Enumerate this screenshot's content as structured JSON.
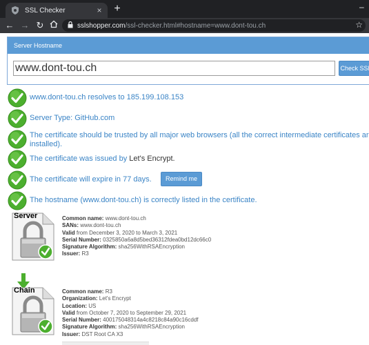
{
  "browser": {
    "tab_title": "SSL Checker",
    "url_host": "sslshopper.com",
    "url_path": "/ssl-checker.html#hostname=www.dont-tou.ch",
    "new_tab": "+",
    "tab_close": "×"
  },
  "form": {
    "header": "Server Hostname",
    "hostname_value": "www.dont-tou.ch",
    "check_button": "Check SSL"
  },
  "results": [
    {
      "text": "www.dont-tou.ch resolves to 185.199.108.153"
    },
    {
      "text": "Server Type: GitHub.com"
    },
    {
      "text": "The certificate should be trusted by all major web browsers (all the correct intermediate certificates are installed)."
    },
    {
      "text_prefix": "The certificate was issued by ",
      "text_value": "Let's Encrypt",
      "text_suffix": "."
    },
    {
      "text": "The certificate will expire in 77 days.",
      "button": "Remind me"
    },
    {
      "text": "The hostname (www.dont-tou.ch) is correctly listed in the certificate."
    }
  ],
  "server_cert": {
    "label": "Server",
    "common_name_label": "Common name:",
    "common_name": "www.dont-tou.ch",
    "sans_label": "SANs:",
    "sans": "www.dont-tou.ch",
    "valid_label": "Valid",
    "valid_text": "from December 3, 2020 to March 3, 2021",
    "serial_label": "Serial Number:",
    "serial": "0325850a6a8d5bed36312fdea0bd12dc66c0",
    "sigalg_label": "Signature Algorithm:",
    "sigalg": "sha256WithRSAEncryption",
    "issuer_label": "Issuer:",
    "issuer": "R3"
  },
  "chain_cert": {
    "label": "Chain",
    "common_name_label": "Common name:",
    "common_name": "R3",
    "org_label": "Organization:",
    "org": "Let's Encrypt",
    "location_label": "Location:",
    "location": "US",
    "valid_label": "Valid",
    "valid_text": "from October 7, 2020 to September 29, 2021",
    "serial_label": "Serial Number:",
    "serial": "400175048314a4c8218c84a90c16cddf",
    "sigalg_label": "Signature Algorithm:",
    "sigalg": "sha256WithRSAEncryption",
    "issuer_label": "Issuer:",
    "issuer": "DST Root CA X3"
  },
  "colors": {
    "accent": "#5b9bd5",
    "link_text": "#3a84c6",
    "check_green": "#4caf2e"
  }
}
